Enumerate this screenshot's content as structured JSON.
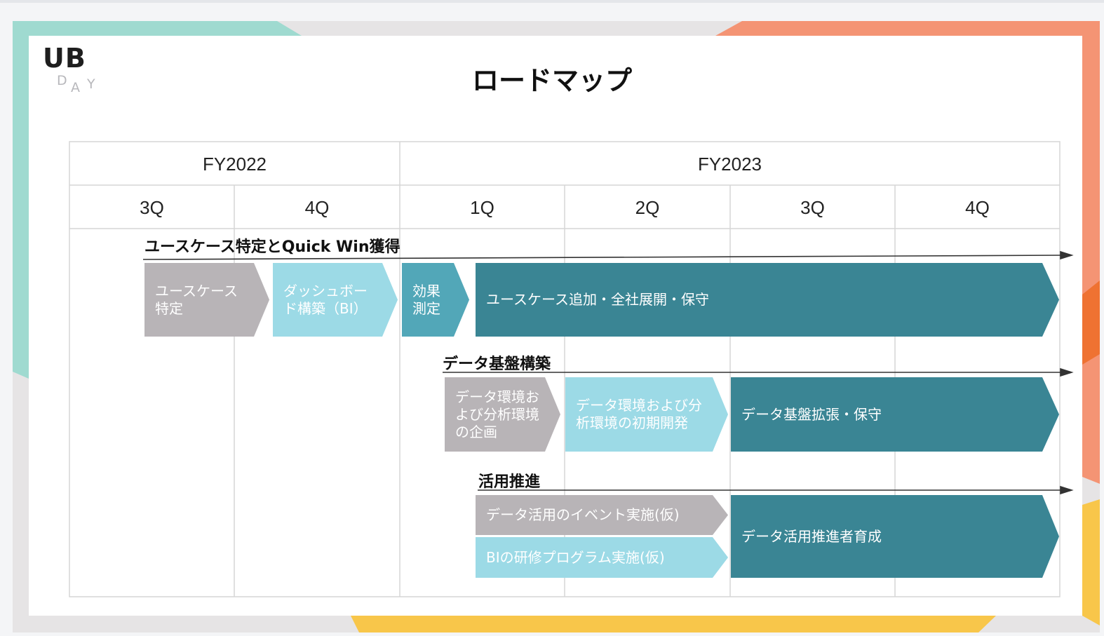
{
  "logo": {
    "main": "UB",
    "sub": [
      "D",
      "A",
      "Y"
    ]
  },
  "title": "ロードマップ",
  "colors": {
    "grey": "#b8b4b7",
    "light_blue": "#9cdae6",
    "mid_teal": "#52a7b8",
    "dark_teal": "#3a8594",
    "decor_mint": "#9fdad0",
    "decor_coral": "#f49474",
    "decor_yellow": "#f8c64a"
  },
  "years": [
    "FY2022",
    "FY2023"
  ],
  "quarters": [
    "3Q",
    "4Q",
    "1Q",
    "2Q",
    "3Q",
    "4Q"
  ],
  "phases": [
    {
      "label": "ユースケース特定とQuick Win獲得",
      "steps": [
        "ユースケース\n特定",
        "ダッシュボー\nド構築（BI）",
        "効果\n測定",
        "ユースケース追加・全社展開・保守"
      ]
    },
    {
      "label": "データ基盤構築",
      "steps": [
        "データ環境お\nよび分析環境\nの企画",
        "データ環境および分\n析環境の初期開発",
        "データ基盤拡張・保守"
      ]
    },
    {
      "label": "活用推進",
      "steps": [
        "データ活用のイベント実施(仮)",
        "BIの研修プログラム実施(仮)",
        "データ活用推進者育成"
      ]
    }
  ]
}
